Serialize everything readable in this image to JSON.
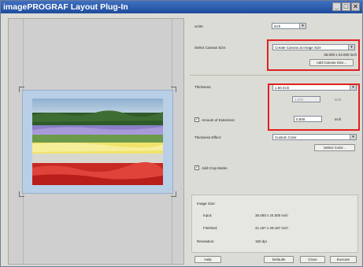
{
  "window": {
    "title": "imagePROGRAF Layout Plug-In",
    "controls": [
      "_",
      "□",
      "×"
    ]
  },
  "settings": {
    "units": {
      "label": "Units:",
      "value": "inch"
    },
    "canvas_size": {
      "label": "Select Canvas Size:",
      "value": "Create Canvas at Image Size",
      "dims": "36.000 x 24.000 inch",
      "add_button": "Add Canvas Size..."
    },
    "thickness": {
      "label": "Thickness:",
      "value": "1.50 inch",
      "disabled_value": "1.500",
      "disabled_unit": "inch"
    },
    "extension": {
      "label": "Amount of Extension:",
      "checked": true,
      "value": "0.500",
      "unit": "inch"
    },
    "thickness_effect": {
      "label": "Thickness Effect:",
      "value": "Custom Color",
      "button": "Select Color..."
    },
    "crop_marks": {
      "label": "Add Crop Marks",
      "checked": true
    }
  },
  "image_info": {
    "size_label": "Image Size:",
    "input_label": "Input:",
    "input_value": "36.000 x 24.000 inch",
    "finished_label": "Finished:",
    "finished_value": "41.167 x 29.167 inch",
    "resolution_label": "Resolution:",
    "resolution_value": "150 dpi"
  },
  "buttons": {
    "help": "Help",
    "defaults": "Defaults",
    "close": "Close",
    "execute": "Execute"
  },
  "colors": {
    "titlebar": "#2a5cb0",
    "highlight": "#e02020",
    "canvas_extension": "#b9cfe6"
  }
}
